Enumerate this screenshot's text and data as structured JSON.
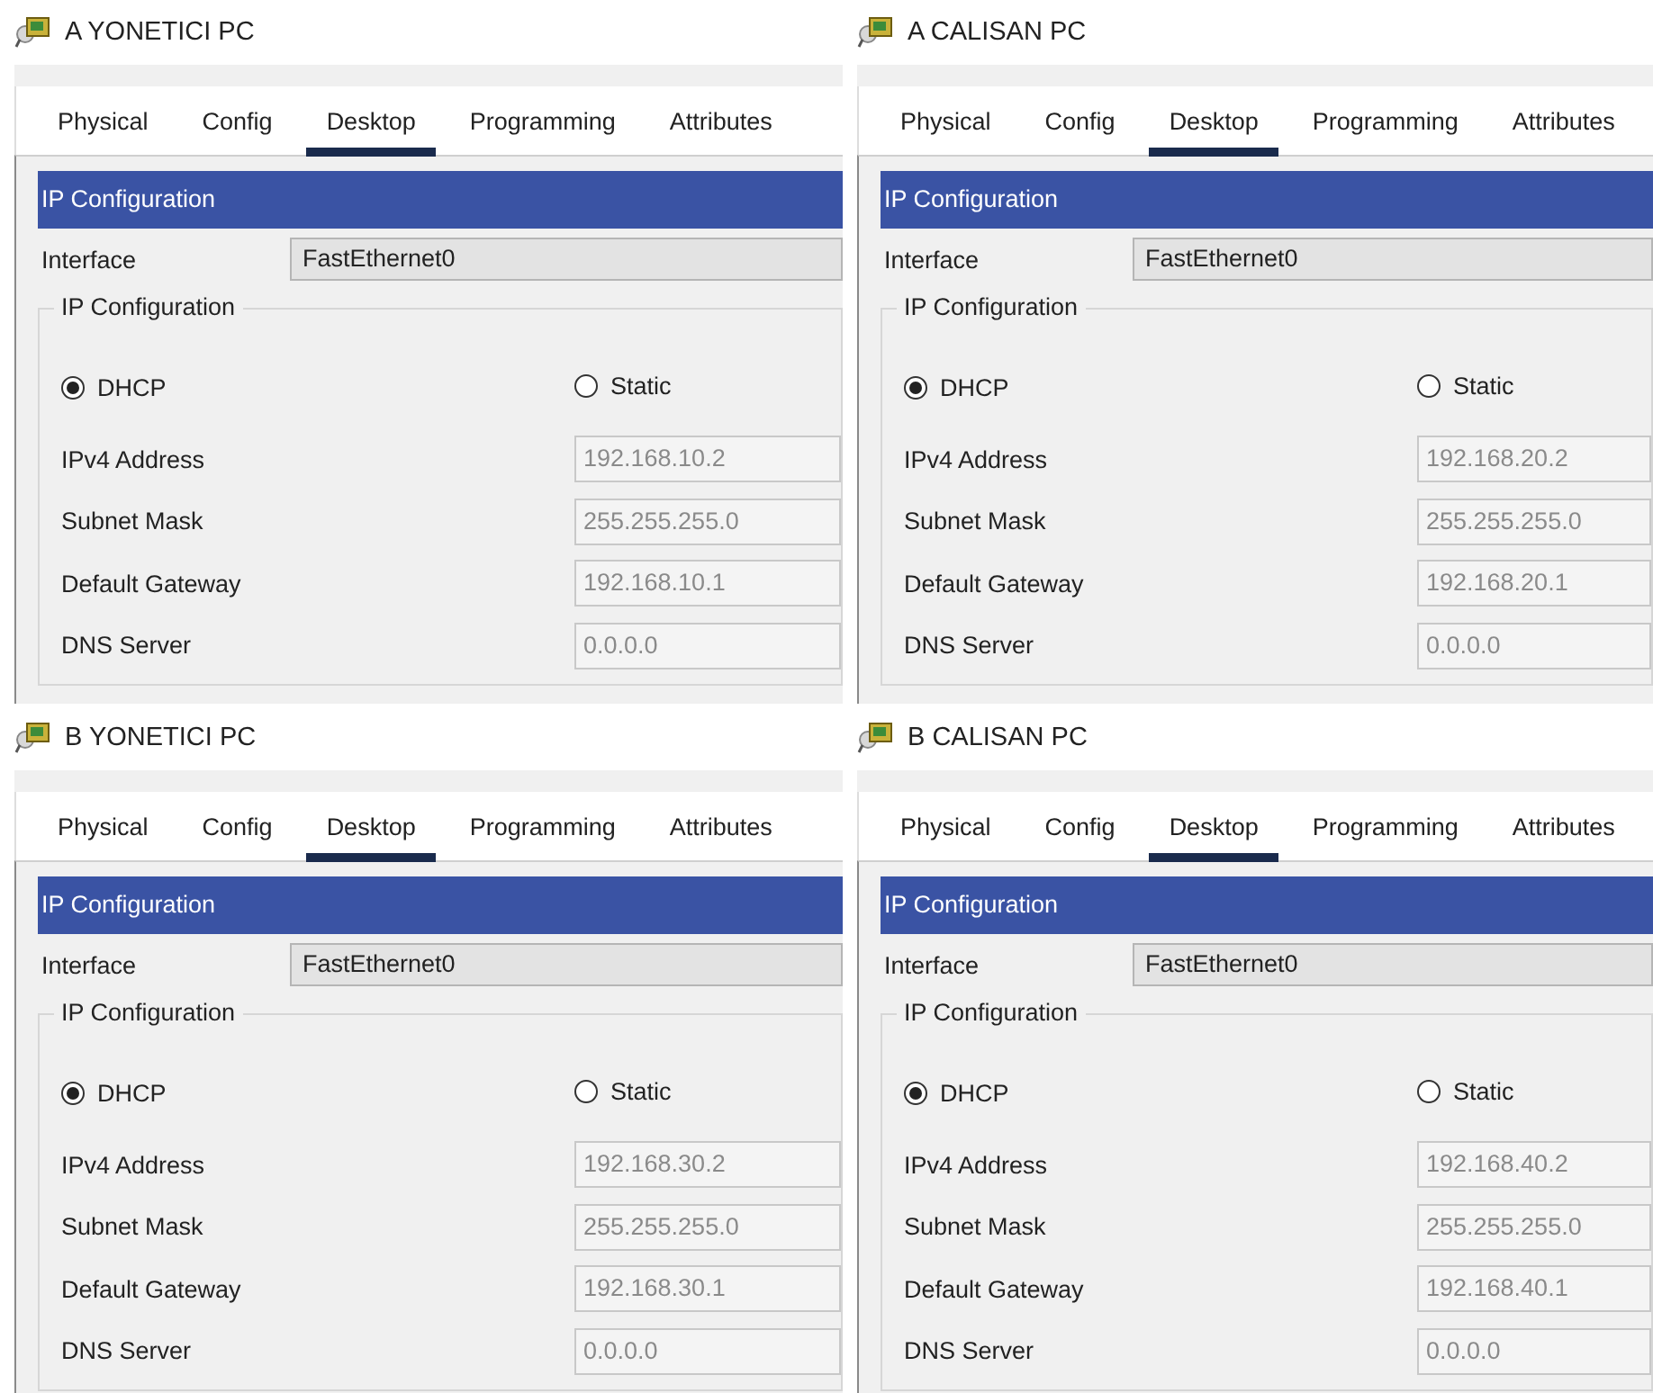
{
  "panels": [
    {
      "title": "A YONETICI PC",
      "tabs": [
        {
          "label": "Physical",
          "selected": false
        },
        {
          "label": "Config",
          "selected": false
        },
        {
          "label": "Desktop",
          "selected": true
        },
        {
          "label": "Programming",
          "selected": false
        },
        {
          "label": "Attributes",
          "selected": false
        }
      ],
      "section_title": "IP Configuration",
      "interface_label": "Interface",
      "interface_value": "FastEthernet0",
      "group_title": "IP Configuration",
      "modes": [
        {
          "label": "DHCP",
          "selected": true
        },
        {
          "label": "Static",
          "selected": false
        }
      ],
      "fields": [
        {
          "label": "IPv4 Address",
          "value": "192.168.10.2"
        },
        {
          "label": "Subnet Mask",
          "value": "255.255.255.0"
        },
        {
          "label": "Default Gateway",
          "value": "192.168.10.1"
        },
        {
          "label": "DNS Server",
          "value": "0.0.0.0"
        }
      ]
    },
    {
      "title": "A CALISAN PC",
      "tabs": [
        {
          "label": "Physical",
          "selected": false
        },
        {
          "label": "Config",
          "selected": false
        },
        {
          "label": "Desktop",
          "selected": true
        },
        {
          "label": "Programming",
          "selected": false
        },
        {
          "label": "Attributes",
          "selected": false
        }
      ],
      "section_title": "IP Configuration",
      "interface_label": "Interface",
      "interface_value": "FastEthernet0",
      "group_title": "IP Configuration",
      "modes": [
        {
          "label": "DHCP",
          "selected": true
        },
        {
          "label": "Static",
          "selected": false
        }
      ],
      "fields": [
        {
          "label": "IPv4 Address",
          "value": "192.168.20.2"
        },
        {
          "label": "Subnet Mask",
          "value": "255.255.255.0"
        },
        {
          "label": "Default Gateway",
          "value": "192.168.20.1"
        },
        {
          "label": "DNS Server",
          "value": "0.0.0.0"
        }
      ]
    },
    {
      "title": "B YONETICI PC",
      "tabs": [
        {
          "label": "Physical",
          "selected": false
        },
        {
          "label": "Config",
          "selected": false
        },
        {
          "label": "Desktop",
          "selected": true
        },
        {
          "label": "Programming",
          "selected": false
        },
        {
          "label": "Attributes",
          "selected": false
        }
      ],
      "section_title": "IP Configuration",
      "interface_label": "Interface",
      "interface_value": "FastEthernet0",
      "group_title": "IP Configuration",
      "modes": [
        {
          "label": "DHCP",
          "selected": true
        },
        {
          "label": "Static",
          "selected": false
        }
      ],
      "fields": [
        {
          "label": "IPv4 Address",
          "value": "192.168.30.2"
        },
        {
          "label": "Subnet Mask",
          "value": "255.255.255.0"
        },
        {
          "label": "Default Gateway",
          "value": "192.168.30.1"
        },
        {
          "label": "DNS Server",
          "value": "0.0.0.0"
        }
      ]
    },
    {
      "title": "B CALISAN PC",
      "tabs": [
        {
          "label": "Physical",
          "selected": false
        },
        {
          "label": "Config",
          "selected": false
        },
        {
          "label": "Desktop",
          "selected": true
        },
        {
          "label": "Programming",
          "selected": false
        },
        {
          "label": "Attributes",
          "selected": false
        }
      ],
      "section_title": "IP Configuration",
      "interface_label": "Interface",
      "interface_value": "FastEthernet0",
      "group_title": "IP Configuration",
      "modes": [
        {
          "label": "DHCP",
          "selected": true
        },
        {
          "label": "Static",
          "selected": false
        }
      ],
      "fields": [
        {
          "label": "IPv4 Address",
          "value": "192.168.40.2"
        },
        {
          "label": "Subnet Mask",
          "value": "255.255.255.0"
        },
        {
          "label": "Default Gateway",
          "value": "192.168.40.1"
        },
        {
          "label": "DNS Server",
          "value": "0.0.0.0"
        }
      ]
    }
  ]
}
